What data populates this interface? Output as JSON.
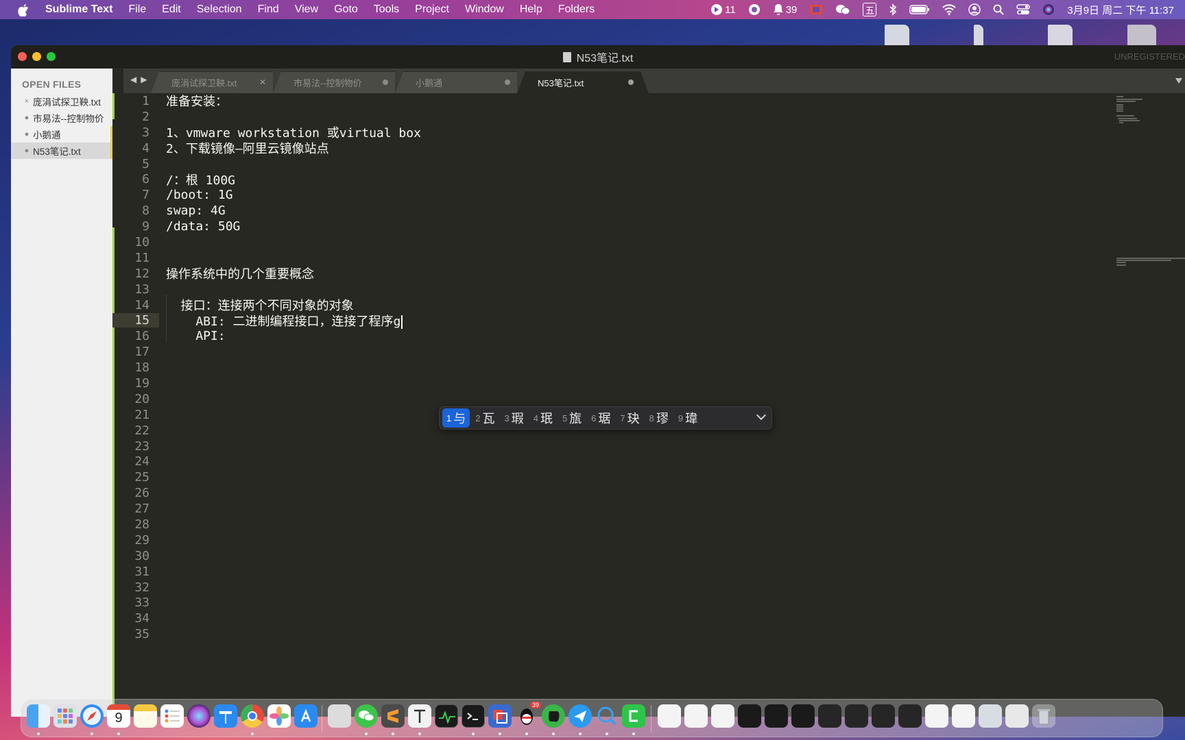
{
  "menubar": {
    "app_name": "Sublime Text",
    "menus": [
      "File",
      "Edit",
      "Selection",
      "Find",
      "View",
      "Goto",
      "Tools",
      "Project",
      "Window",
      "Help",
      "Folders"
    ],
    "status": {
      "badge1_count": "11",
      "notifications_count": "39",
      "ime_label": "五",
      "datetime": "3月9日 周二 下午 11:37"
    }
  },
  "window": {
    "title": "N53笔记.txt",
    "unregistered": "UNREGISTERED"
  },
  "sidebar": {
    "header": "OPEN FILES",
    "items": [
      {
        "label": "庞涓试探卫鞅.txt",
        "mark": "×"
      },
      {
        "label": "市易法--控制物价",
        "mark": "●"
      },
      {
        "label": "小鹅通",
        "mark": "●"
      },
      {
        "label": "N53笔记.txt",
        "mark": "●"
      }
    ]
  },
  "tabs": [
    {
      "label": "庞涓试探卫鞅.txt"
    },
    {
      "label": "市易法--控制物价"
    },
    {
      "label": "小鹅通"
    },
    {
      "label": "N53笔记.txt"
    }
  ],
  "editor": {
    "lines": [
      "准备安装：",
      "",
      "1、vmware workstation 或virtual box",
      "2、下载镜像—阿里云镜像站点",
      "",
      "/：根 100G",
      "/boot: 1G",
      "swap: 4G",
      "/data: 50G",
      "",
      "",
      "操作系统中的几个重要概念",
      "",
      "  接口：连接两个不同对象的对象",
      "    ABI: 二进制编程接口，连接了程序g",
      "    API:",
      "",
      "",
      "",
      "",
      "",
      "",
      "",
      "",
      "",
      "",
      "",
      "",
      "",
      "",
      "",
      "",
      "",
      "",
      ""
    ],
    "line_numbers": [
      "1",
      "2",
      "3",
      "4",
      "5",
      "6",
      "7",
      "8",
      "9",
      "10",
      "11",
      "12",
      "13",
      "14",
      "15",
      "16",
      "17",
      "18",
      "19",
      "20",
      "21",
      "22",
      "23",
      "24",
      "25",
      "26",
      "27",
      "28",
      "29",
      "30",
      "31",
      "32",
      "33",
      "34",
      "35"
    ],
    "current_line": 15
  },
  "ime": {
    "candidates": [
      {
        "n": "1",
        "c": "与"
      },
      {
        "n": "2",
        "c": "瓦"
      },
      {
        "n": "3",
        "c": "瑕"
      },
      {
        "n": "4",
        "c": "珉"
      },
      {
        "n": "5",
        "c": "旊"
      },
      {
        "n": "6",
        "c": "琚"
      },
      {
        "n": "7",
        "c": "玦"
      },
      {
        "n": "8",
        "c": "璆"
      },
      {
        "n": "9",
        "c": "瑋"
      }
    ]
  },
  "dock": {
    "calendar_day": "9",
    "qq_badge": "39"
  },
  "colors": {
    "editor_bg": "#272822",
    "sidebar_bg": "#f0f0f0",
    "ime_selected": "#1a63d8",
    "modified_gutter": "#9fd73a"
  }
}
